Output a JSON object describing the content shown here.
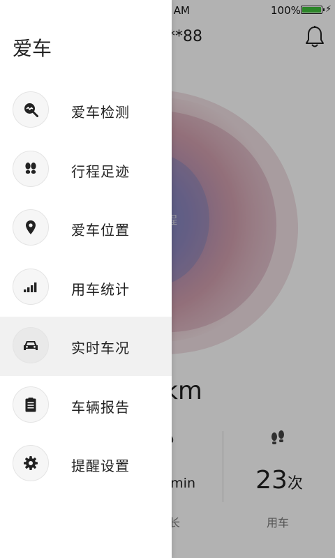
{
  "status_bar": {
    "time": "AM",
    "battery_text": "100%",
    "battery_level": 1.0,
    "battery_color": "#3fc13c"
  },
  "background": {
    "plate_partial": "**88",
    "bell_icon": "bell-icon",
    "blob_label": "程",
    "blob_colors": [
      "#b9677c",
      "#7b6bb3",
      "#5d82c4"
    ],
    "distance_unit": "km",
    "left_stat": {
      "value": "min",
      "label": "长",
      "icon": "clock-icon"
    },
    "right_stat": {
      "value_number": "23",
      "value_unit": "次",
      "label": "用车",
      "icon": "footprints-icon"
    }
  },
  "drawer": {
    "title": "爱车",
    "items": [
      {
        "label": "爱车检测",
        "icon": "car-detect-icon",
        "active": false
      },
      {
        "label": "行程足迹",
        "icon": "footprints-icon",
        "active": false
      },
      {
        "label": "爱车位置",
        "icon": "location-pin-icon",
        "active": false
      },
      {
        "label": "用车统计",
        "icon": "bar-chart-icon",
        "active": false
      },
      {
        "label": "实时车况",
        "icon": "car-icon",
        "active": true
      },
      {
        "label": "车辆报告",
        "icon": "clipboard-icon",
        "active": false
      },
      {
        "label": "提醒设置",
        "icon": "gear-icon",
        "active": false
      }
    ]
  },
  "colors": {
    "overlay": "rgba(0,0,0,0.30)",
    "active_item_bg": "#f1f1f1",
    "text": "#222222"
  }
}
